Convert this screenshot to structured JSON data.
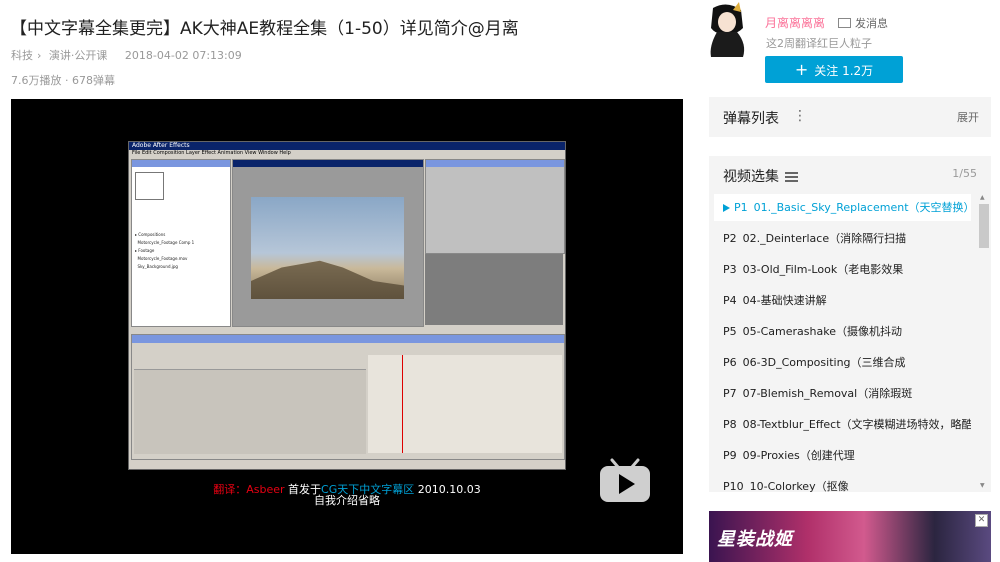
{
  "video": {
    "title": "【中文字幕全集更完】AK大神AE教程全集（1-50）详见简介@月离",
    "category": "科技",
    "subcategory": "演讲·公开课",
    "date": "2018-04-02 07:13:09",
    "stats": "7.6万播放 · 678弹幕"
  },
  "player": {
    "sub_line1_prefix": "翻译：Asbeer",
    "sub_line1_mid": "首发于",
    "sub_line1_site": "CG天下中文字幕区",
    "sub_line1_date": "2010.10.03",
    "sub_line2": "自我介绍省略",
    "ae_window_title": "Adobe After Effects",
    "ae_menu": "File  Edit  Composition  Layer  Effect  Animation  View  Window  Help"
  },
  "uploader": {
    "name": "月离离离离",
    "message_label": "发消息",
    "signature": "这2周翻译红巨人粒子",
    "follow_label": "关注 1.2万"
  },
  "danmaku": {
    "label": "弹幕列表",
    "expand_label": "展开"
  },
  "playlist": {
    "header": "视频选集",
    "count": "1/55",
    "items": [
      {
        "num": "P1",
        "title": "01._Basic_Sky_Replacement（天空替换）"
      },
      {
        "num": "P2",
        "title": "02._Deinterlace（消除隔行扫描"
      },
      {
        "num": "P3",
        "title": "03-Old_Film-Look（老电影效果"
      },
      {
        "num": "P4",
        "title": "04-基础快速讲解"
      },
      {
        "num": "P5",
        "title": "05-Camerashake（摄像机抖动"
      },
      {
        "num": "P6",
        "title": "06-3D_Compositing（三维合成"
      },
      {
        "num": "P7",
        "title": "07-Blemish_Removal（消除瑕斑"
      },
      {
        "num": "P8",
        "title": "08-Textblur_Effect（文字模糊进场特效，略酷"
      },
      {
        "num": "P9",
        "title": "09-Proxies（创建代理"
      },
      {
        "num": "P10",
        "title": "10-Colorkey（抠像"
      }
    ]
  },
  "ad": {
    "text": "星装战姬",
    "close_label": "✕"
  },
  "colors": {
    "accent": "#00a1d6",
    "uploader_pink": "#fb7299"
  }
}
